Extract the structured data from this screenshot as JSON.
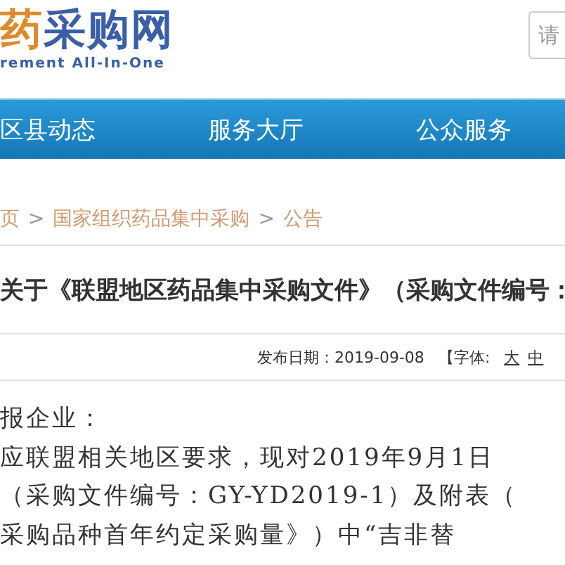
{
  "header": {
    "logo_title": "药采购网",
    "logo_subtitle": "rement All-In-One",
    "search": {
      "placeholder": "请"
    }
  },
  "nav": [
    {
      "label": "区县动态"
    },
    {
      "label": "服务大厅"
    },
    {
      "label": "公众服务"
    }
  ],
  "breadcrumb": [
    "页",
    ">",
    "国家组织药品集中采购",
    ">",
    "公告"
  ],
  "article": {
    "title": "关于《联盟地区药品集中采购文件》（采购文件编号：",
    "date": "发布日期：2019-09-08",
    "font_label": "【字体:",
    "font_sizes": [
      "大",
      "中"
    ],
    "body": [
      "报企业：",
      "应联盟相关地区要求，现对2019年9月1日",
      "（采购文件编号：GY-YD2019-1）及附表（",
      "采购品种首年约定采购量》）中“吉非替"
    ]
  }
}
